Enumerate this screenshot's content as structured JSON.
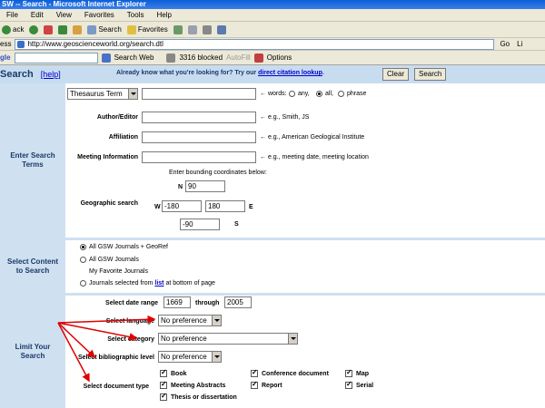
{
  "window": {
    "title": "SW -- Search - Microsoft Internet Explorer"
  },
  "menu": [
    "File",
    "Edit",
    "View",
    "Favorites",
    "Tools",
    "Help"
  ],
  "toolbar": {
    "back": "ack",
    "search": "Search",
    "favorites": "Favorites"
  },
  "address": {
    "label": "ess",
    "url": "http://www.geoscienceworld.org/search.dtl",
    "go": "Go",
    "links": "Li"
  },
  "googlebar": {
    "logo": "gle",
    "search_web": "Search Web",
    "blocked": "3316 blocked",
    "autofill": "AutoFill",
    "options": "Options"
  },
  "header": {
    "title": "Search",
    "help": "[help]",
    "already_text": "Already know what you're looking for? Try our ",
    "citation_link": "direct citation lookup",
    "period": ".",
    "clear": "Clear",
    "search": "Search"
  },
  "enter_terms": {
    "section": "Enter Search Terms",
    "term_select": "Thesaurus Term",
    "words_label": "words:",
    "radio_any": "any,",
    "radio_all": "all,",
    "radio_phrase": "phrase",
    "author_label": "Author/Editor",
    "author_hint": "e.g., Smith, JS",
    "affiliation_label": "Affiliation",
    "affiliation_hint": "e.g., American Geological Institute",
    "meeting_label": "Meeting Information",
    "meeting_hint": "e.g., meeting date, meeting location",
    "bounding_text": "Enter bounding coordinates below:",
    "geo_label": "Geographic search",
    "n": "N",
    "w": "W",
    "e": "E",
    "s": "S",
    "n_val": "90",
    "w_val": "-180",
    "e_val": "180",
    "s_val": "-90"
  },
  "content": {
    "section": "Select Content to Search",
    "opt1": "All GSW Journals + GeoRef",
    "opt2": "All GSW Journals",
    "opt3": "My Favorite Journals",
    "opt4_pre": "Journals selected from ",
    "opt4_link": "list",
    "opt4_post": " at bottom of page"
  },
  "limit": {
    "section": "Limit Your Search",
    "date_label": "Select date range",
    "date_from": "1669",
    "through": "through",
    "date_to": "2005",
    "language_label": "Select language",
    "language_value": "No preference",
    "category_label": "Select category",
    "category_value": "No preference",
    "biblio_label": "Select bibliographic level",
    "biblio_value": "No preference",
    "doctype_label": "Select document type",
    "types": {
      "book": "Book",
      "meeting_abstracts": "Meeting Abstracts",
      "thesis": "Thesis or dissertation",
      "conference": "Conference document",
      "report": "Report",
      "map": "Map",
      "serial": "Serial"
    }
  },
  "colors": {
    "section_bg": "#cfe0f0",
    "header_bg": "#c8dcf0",
    "annotation_arrow": "#e00000"
  }
}
